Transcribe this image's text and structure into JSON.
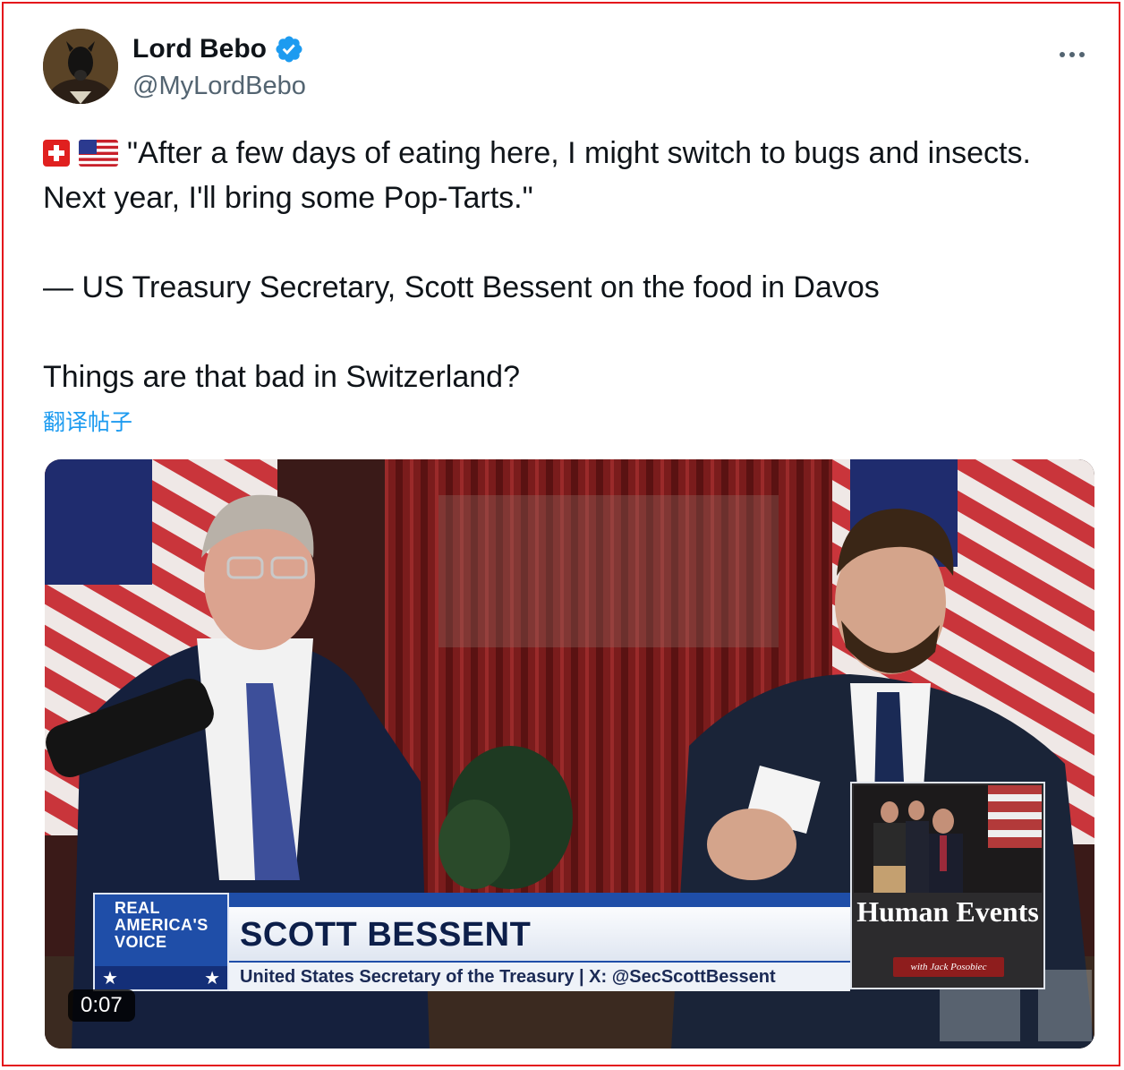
{
  "tweet": {
    "author_name": "Lord Bebo",
    "author_handle": "@MyLordBebo",
    "verified": true,
    "flags": [
      "swiss-flag-icon",
      "us-flag-icon"
    ],
    "quote_text": "\"After a few days of eating here, I might switch to bugs and insects. Next year, I'll bring some Pop-Tarts.\"",
    "attribution": "— US Treasury Secretary, Scott Bessent on the food in Davos",
    "comment": "Things are that bad in Switzerland?",
    "translate_label": "翻译帖子"
  },
  "video": {
    "timestamp": "0:07",
    "network_logo_text": "REAL AMERICA'S VOICE",
    "lower_third_name": "SCOTT BESSENT",
    "lower_third_subtitle": "United States Secretary of the Treasury | X: @SecScottBessent",
    "show_title": "Human Events",
    "show_subtitle": "with Jack Posobiec"
  },
  "colors": {
    "accent_blue": "#1d9bf0",
    "frame_red": "#e4141b",
    "rav_blue": "#1f4ea8"
  }
}
